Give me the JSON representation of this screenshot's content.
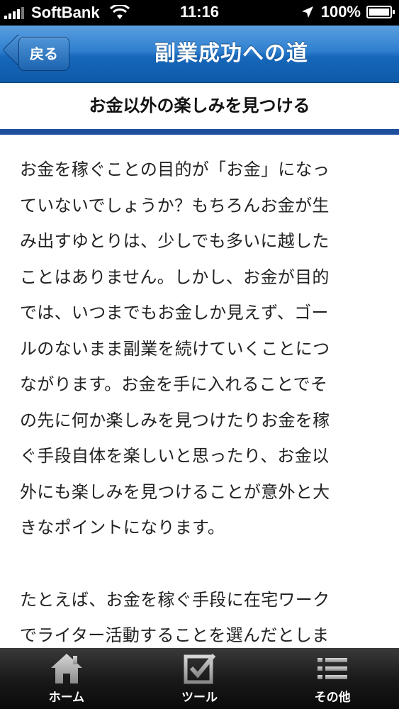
{
  "status_bar": {
    "carrier": "SoftBank",
    "time": "11:16",
    "battery_percent": "100%",
    "battery_level": 1.0
  },
  "nav": {
    "back_label": "戻る",
    "title": "副業成功への道"
  },
  "section": {
    "title": "お金以外の楽しみを見つける"
  },
  "article": {
    "lines": [
      "お金を稼ぐことの目的が「お金」になっ",
      "ていないでしょうか？もちろんお金が生",
      "み出すゆとりは、少しでも多いに越した",
      "ことはありません。しかし、お金が目的",
      "では、いつまでもお金しか見えず、ゴー",
      "ルのないまま副業を続けていくことにつ",
      "ながります。お金を手に入れることでそ",
      "の先に何か楽しみを見つけたりお金を稼",
      "ぐ手段自体を楽しいと思ったり、お金以",
      "外にも楽しみを見つけることが意外と大",
      "きなポイントになります。",
      "",
      "たとえば、お金を稼ぐ手段に在宅ワーク",
      "でライター活動することを選んだとしま"
    ]
  },
  "tab_bar": {
    "items": [
      {
        "label": "ホーム",
        "icon": "home-icon"
      },
      {
        "label": "ツール",
        "icon": "checkbox-icon"
      },
      {
        "label": "その他",
        "icon": "list-icon"
      }
    ]
  },
  "colors": {
    "nav_blue": "#1667bb",
    "section_rule": "#1e4f9d",
    "tab_bar": "#1a1a1a"
  }
}
